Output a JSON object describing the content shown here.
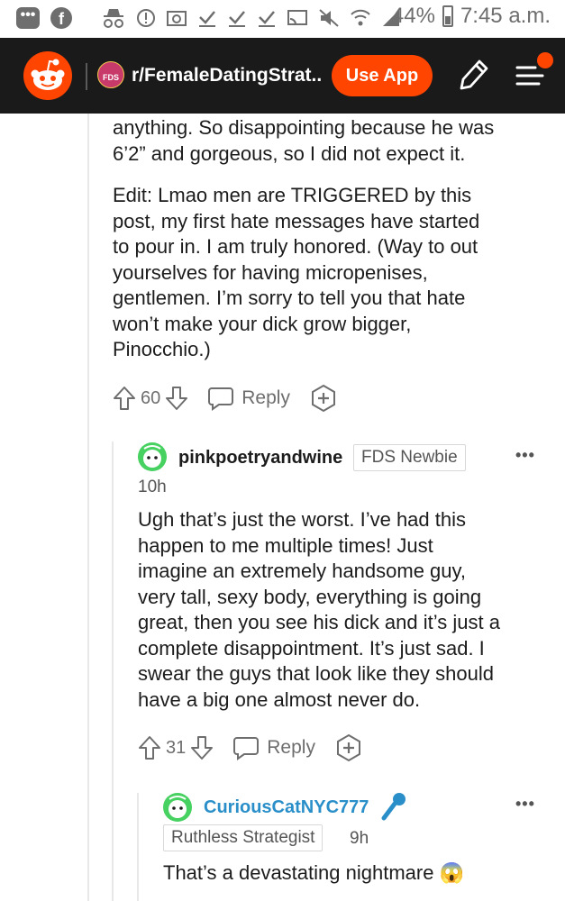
{
  "status_bar": {
    "battery": "44%",
    "time": "7:45 a.m."
  },
  "header": {
    "subreddit": "r/FemaleDatingStrat...",
    "subreddit_icon_text": "FDS",
    "use_app_label": "Use App"
  },
  "post_comment": {
    "lines": [
      "anything. So disappointing because he was",
      "6’2” and gorgeous, so I did not expect it.",
      "",
      "Edit: Lmao men are TRIGGERED by this",
      "post, my first hate messages have started",
      "to pour in. I am truly honored. (Way to out",
      "yourselves for having micropenises,",
      "gentlemen. I’m sorry to tell you that hate",
      "won’t make your dick grow bigger,",
      "Pinocchio.)"
    ],
    "votes": "60",
    "reply_label": "Reply"
  },
  "reply1": {
    "username": "pinkpoetryandwine",
    "flair": "FDS Newbie",
    "time": "10h",
    "lines": [
      "Ugh that’s just the worst. I’ve had this",
      "happen to me multiple times! Just",
      "imagine an extremely handsome guy,",
      "very tall, sexy body, everything is going",
      "great, then you see his dick and it’s just a",
      "complete disappointment. It’s just sad. I",
      "swear the guys that look like they should",
      "have a big one almost never do."
    ],
    "votes": "31",
    "reply_label": "Reply",
    "more": "•••"
  },
  "reply2": {
    "username": "CuriousCatNYC777",
    "flair": "Ruthless Strategist",
    "time": "9h",
    "text": "That’s a devastating nightmare",
    "emoji": "😱",
    "more": "•••"
  },
  "colors": {
    "reddit_orange": "#ff4500",
    "header_bg": "#1a1a1b",
    "username_blue": "#2a8fc9",
    "avatar_green": "#46d160"
  }
}
